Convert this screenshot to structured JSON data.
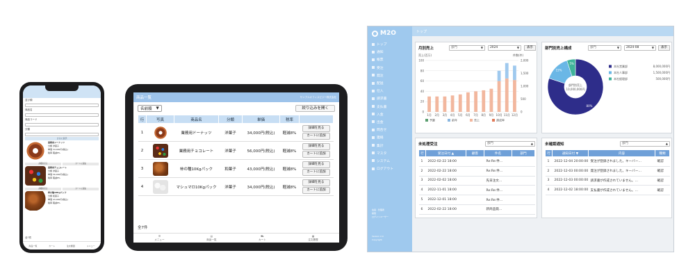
{
  "phone": {
    "header": "ショッピング",
    "labels": [
      "並び順",
      "商品名",
      "商品コード",
      "分類"
    ],
    "band_label": "さらに表示",
    "items": [
      {
        "name": "業務用ドーナッツ",
        "cat": "分類 洋菓子",
        "price": "単価 34,000円(税込)",
        "tax": "税率 軽減8%",
        "detail": "詳細を見る",
        "cart": "カートに追加"
      },
      {
        "name": "業務用チョコレート",
        "cat": "分類 洋菓子",
        "price": "単価 56,000円(税込)",
        "tax": "税率 軽減8%",
        "detail": "詳細を見る",
        "cart": "カートに追加"
      },
      {
        "name": "柿の種10Kgパック",
        "cat": "分類 和菓子",
        "price": "単価 43,000円(税込)",
        "tax": "税率 軽減8%",
        "detail": "詳細を見る",
        "cart": "カートに追加"
      }
    ],
    "count": "全7件",
    "footer": [
      "商品一覧",
      "カート",
      "注文履歴",
      "メニュー"
    ]
  },
  "tablet": {
    "title": "商品一覧",
    "user": "サンプルオフィスビジー株式会社",
    "sort_label": "名前順",
    "filter_button": "絞り込みを開く",
    "headers": [
      "行",
      "写真",
      "商品名",
      "分類",
      "単価",
      "税率"
    ],
    "rows": [
      {
        "no": "1",
        "name": "業務用ドーナッツ",
        "cat": "洋菓子",
        "price": "34,000円(税込)",
        "tax": "軽減8%"
      },
      {
        "no": "2",
        "name": "業務用チョコレート",
        "cat": "洋菓子",
        "price": "56,000円(税込)",
        "tax": "軽減8%"
      },
      {
        "no": "3",
        "name": "柿の種10Kgパック",
        "cat": "和菓子",
        "price": "43,000円(税込)",
        "tax": "軽減8%"
      },
      {
        "no": "4",
        "name": "マシュマロ10Kgパック",
        "cat": "洋菓子",
        "price": "34,000円(税込)",
        "tax": "軽減8%"
      }
    ],
    "detail_button": "詳細を見る",
    "cart_button": "カートに追加",
    "count": "全7件",
    "footer": [
      "メニュー",
      "商品一覧",
      "カート",
      "注文履歴"
    ]
  },
  "dashboard": {
    "logo": "M2O",
    "breadcrumb": "トップ",
    "menu": [
      "トップ",
      "通知",
      "帳票",
      "受注",
      "発注",
      "配送",
      "仕入",
      "請求書",
      "支払書",
      "入金",
      "出金",
      "問合せ",
      "連絡",
      "集計",
      "マスタ",
      "システム",
      "ログアウト"
    ],
    "side_footer": [
      "会員 : 管理者",
      "権限",
      "ログインユーザー",
      "Version 2.0",
      "Copyright"
    ],
    "monthly": {
      "title": "月別売上",
      "dept_placeholder": "部門",
      "year": "2024",
      "show": "表示",
      "left_unit": "売上(百万)",
      "right_unit": "件数(件)"
    },
    "pie": {
      "title": "部門別売上構成",
      "dept_placeholder": "部門",
      "period": "2024-08",
      "show": "表示",
      "center_label": "部門別売上",
      "center_value": "10,000,000円"
    },
    "orders": {
      "title": "未処理受注",
      "dept_placeholder": "部門",
      "headers": [
        "行",
        "受注日付 ▲",
        "顧客",
        "件名",
        "部門"
      ],
      "rows": [
        [
          "1",
          "2022-02-22 18:00",
          "",
          "Re:Re:件…",
          ""
        ],
        [
          "2",
          "2022-02-22 18:00",
          "",
          "Re:Re:件…",
          ""
        ],
        [
          "3",
          "2022-02-02 18:00",
          "",
          "先日注文…",
          ""
        ],
        [
          "4",
          "2022-11-01 18:00",
          "",
          "Re:Re:件…",
          ""
        ],
        [
          "5",
          "2022-12-01 18:00",
          "",
          "Re:Re:件…",
          ""
        ],
        [
          "6",
          "2022-02-22 18:00",
          "",
          "新商品発…",
          ""
        ]
      ]
    },
    "notices": {
      "title": "未確認通知",
      "dept_placeholder": "部門",
      "headers": [
        "行",
        "通知日付 ▼",
        "内容",
        "種類"
      ],
      "rows": [
        [
          "1",
          "2022-12-04 20:00:00",
          "受注が登録されました。キーバー…",
          "確認"
        ],
        [
          "2",
          "2022-12-03 00:00:00",
          "発注が登録されました。キーバー…",
          "確認"
        ],
        [
          "3",
          "2022-12-03 00:00:00",
          "請求書が作成されていません。…",
          "確認"
        ],
        [
          "4",
          "2022-12-02 18:00:00",
          "支払書が作成されていません。…",
          "確認"
        ]
      ]
    }
  },
  "chart_data": [
    {
      "type": "bar",
      "title": "月別売上",
      "categories": [
        "1月",
        "2月",
        "3月",
        "4月",
        "5月",
        "6月",
        "7月",
        "8月",
        "9月",
        "10月",
        "11月",
        "12月"
      ],
      "series": [
        {
          "name": "",
          "values": [
            30,
            30,
            30,
            32,
            34,
            38,
            40,
            42,
            45,
            60,
            65,
            62
          ],
          "color": "#f2b79e"
        },
        {
          "name": "",
          "values": [
            0,
            0,
            0,
            0,
            0,
            0,
            0,
            0,
            0,
            20,
            30,
            28
          ],
          "color": "#9fc9ee"
        }
      ],
      "ylim_left": [
        0,
        100
      ],
      "left_ticks": [
        "0",
        "20",
        "40",
        "60",
        "80",
        "100"
      ],
      "right_ticks": [
        "0",
        "500",
        "1,000",
        "1,500",
        "2,000"
      ],
      "legend": [
        "予算",
        "前年",
        "売上",
        "達成率"
      ],
      "legend_colors": [
        "#5a9e6f",
        "#8ab7e0",
        "#f2b79e",
        "#e07b5a"
      ]
    },
    {
      "type": "pie",
      "title": "部門別売上構成",
      "series": [
        {
          "name": "本社営業部",
          "value": 80,
          "amount": "8,000,000円",
          "color": "#2e2d8a"
        },
        {
          "name": "本社人事部",
          "value": 15,
          "amount": "1,500,000円",
          "color": "#6ab7e6"
        },
        {
          "name": "本社経理部",
          "value": 5,
          "amount": "500,000円",
          "color": "#3fb39a"
        }
      ],
      "slice_labels": [
        "80%",
        "15%",
        "5%"
      ]
    }
  ]
}
